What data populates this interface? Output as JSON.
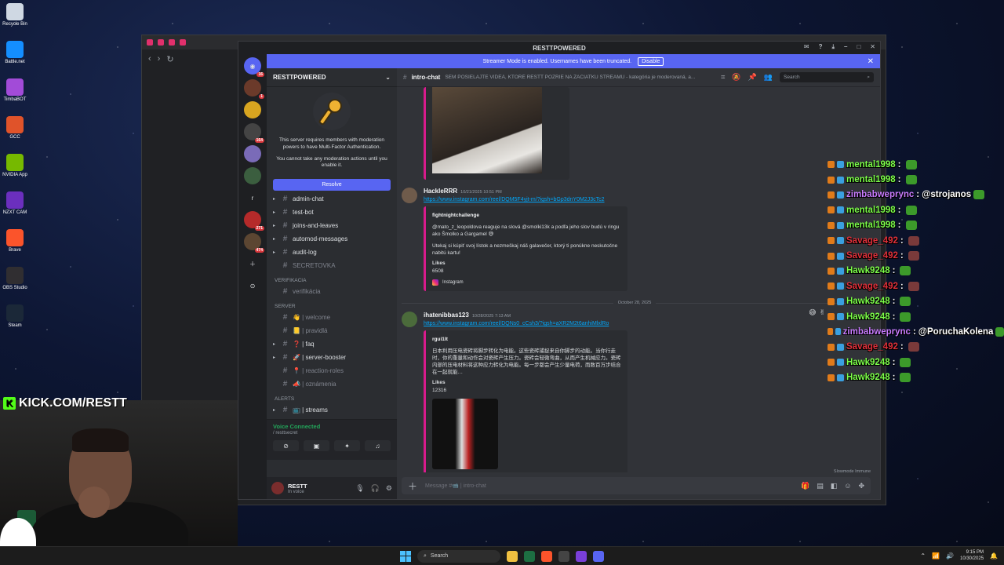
{
  "desktop": {
    "icons": [
      {
        "label": "Recycle Bin",
        "color": "#cfd8e3"
      },
      {
        "label": "Battle.net",
        "color": "#148eff"
      },
      {
        "label": "TimbaBOT",
        "color": "#a24bd8"
      },
      {
        "label": "GCC",
        "color": "#e0532a"
      },
      {
        "label": "NVIDIA App",
        "color": "#76b900"
      },
      {
        "label": "NZXT CAM",
        "color": "#6b2fbe"
      },
      {
        "label": "Brave",
        "color": "#fb542b"
      },
      {
        "label": "OBS Studio",
        "color": "#302e31"
      },
      {
        "label": "Steam",
        "color": "#1b2838"
      }
    ]
  },
  "discord": {
    "window_title": "RESTTPOWERED",
    "streamer_banner": "Streamer Mode is enabled. Usernames have been truncated.",
    "disable_label": "Disable",
    "guild_badges": [
      "16",
      "1",
      "164",
      "271",
      "474"
    ],
    "guild_letter": "r",
    "server_name": "RESTTPOWERED",
    "mfa_text_1": "This server requires members with moderation powers to have Multi-Factor Authentication.",
    "mfa_text_2": "You cannot take any moderation actions until you enable it.",
    "resolve_label": "Resolve",
    "channels_top": [
      {
        "name": "admin-chat",
        "muted": false
      },
      {
        "name": "test-bot",
        "muted": false
      },
      {
        "name": "joins-and-leaves",
        "muted": false
      },
      {
        "name": "automod-messages",
        "muted": false
      },
      {
        "name": "audit-log",
        "muted": false
      },
      {
        "name": "SECRETOVKA",
        "muted": true
      }
    ],
    "cat_verifikacia": "VERIFIKACIA",
    "ch_verifikacia": "verifikácia",
    "cat_server": "SERVER",
    "channels_server": [
      {
        "name": "👋 | welcome",
        "muted": true
      },
      {
        "name": "📒 | pravidlá",
        "muted": true
      },
      {
        "name": "❓ | faq",
        "muted": false
      },
      {
        "name": "🚀 | server-booster",
        "muted": false
      },
      {
        "name": "📍 | reaction-roles",
        "muted": true
      },
      {
        "name": "📣 | oznámenia",
        "muted": true
      }
    ],
    "cat_alerts": "ALERTS",
    "ch_streams": "📺 | streams",
    "voice_status": "Voice Connected",
    "voice_channel": "/ resttsecret",
    "user_name": "RESTT",
    "user_status": "In voice",
    "chat": {
      "channel": "intro-chat",
      "topic": "SEM POSIELAJTE VIDEÁ, KTORÉ RESTT POZRIE NA ZAČIATKU STREAMU - kategória je moderovaná, a...",
      "search_placeholder": "Search",
      "messages": [
        {
          "author": "HackleRRR",
          "time": "10/21/2025 10:51 PM",
          "link": "https://www.instagram.com/reel/DQM5F4yjt-m/?igsh=bGp3dnY0M2J3cTc2",
          "embed_title": "fightnightchallenge",
          "embed_desc": "@mato_z_leopoldova reaguje na slová @smolki13k a podľa jeho slov budú v ringu ako Šmolko a Gargamel 😅",
          "embed_desc2": "Utekaj si kúpiť svoj lístok a nezmeškaj náš galavečer, ktorý ti ponúkne neskutočne nabitú kartu!",
          "likes_label": "Likes",
          "likes": "6508",
          "provider": "Instagram"
        },
        {
          "author": "ihatenibbas123",
          "time": "10/28/2025 7:13 AM",
          "link": "https://www.instagram.com/reel/DQNs0_cCsh3/?igsh=aXR2M2t6anhiMlxlRo",
          "embed_title": "rgui1It",
          "embed_desc": "日本利用压电瓷砖将脚步转化为电能。这些瓷砖捕捉来自你脚步的动能。当你行走时，你的重量和动作会对瓷砖产生压力。瓷砖会轻微弯曲，从而产生机械应力。瓷砖内部的压电材料将这种应力转化为电能。每一步都会产生少量电荷，而数百万步结合在一起就能…",
          "likes_label": "Likes",
          "likes": "12316"
        }
      ],
      "date_divider": "October 28, 2025",
      "compose_placeholder": "Message #📹 | intro-chat",
      "slowmode": "Slowmode Immune"
    }
  },
  "overlay": {
    "lines": [
      {
        "user": "mental1998",
        "color": "#7dff4a",
        "text": ""
      },
      {
        "user": "mental1998",
        "color": "#7dff4a",
        "text": ""
      },
      {
        "user": "zimbabweprync",
        "color": "#c97cff",
        "text": "@strojanos"
      },
      {
        "user": "mental1998",
        "color": "#7dff4a",
        "text": ""
      },
      {
        "user": "mental1998",
        "color": "#7dff4a",
        "text": ""
      },
      {
        "user": "Savage_492",
        "color": "#e0303a",
        "text": ""
      },
      {
        "user": "Savage_492",
        "color": "#e0303a",
        "text": ""
      },
      {
        "user": "Hawk9248",
        "color": "#7dff4a",
        "text": ""
      },
      {
        "user": "Savage_492",
        "color": "#e0303a",
        "text": ""
      },
      {
        "user": "Hawk9248",
        "color": "#7dff4a",
        "text": ""
      },
      {
        "user": "Hawk9248",
        "color": "#7dff4a",
        "text": ""
      },
      {
        "user": "zimbabweprync",
        "color": "#c97cff",
        "text": "@PoruchaKolena"
      },
      {
        "user": "Savage_492",
        "color": "#e0303a",
        "text": ""
      },
      {
        "user": "Hawk9248",
        "color": "#7dff4a",
        "text": ""
      },
      {
        "user": "Hawk9248",
        "color": "#7dff4a",
        "text": ""
      }
    ]
  },
  "stream": {
    "kick_text": "KICK.COM/RESTT"
  },
  "taskbar": {
    "search": "Search",
    "time": "9:15 PM",
    "date": "10/30/2025"
  }
}
